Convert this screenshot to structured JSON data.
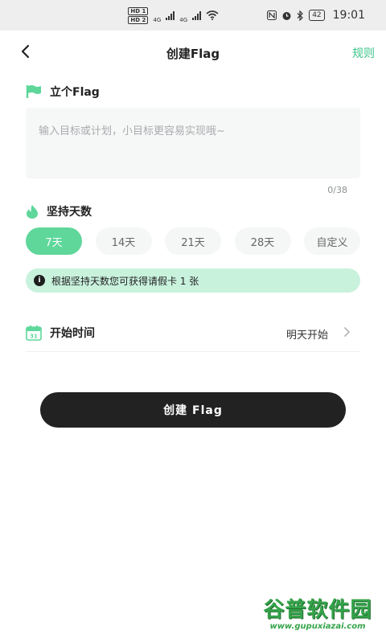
{
  "status_bar": {
    "hd1": "HD 1",
    "hd2": "HD 2",
    "net1": "4G",
    "net2": "4G",
    "battery": "42",
    "time": "19:01"
  },
  "nav": {
    "back_icon": "chevron-left-icon",
    "title": "创建Flag",
    "rules_label": "规则"
  },
  "flag_section": {
    "icon": "flag-icon",
    "title": "立个Flag",
    "placeholder": "输入目标或计划，小目标更容易实现哦~",
    "char_count": "0/38"
  },
  "days_section": {
    "icon": "flame-icon",
    "title": "坚持天数",
    "options": [
      "7天",
      "14天",
      "21天",
      "28天",
      "自定义"
    ],
    "selected": "7天"
  },
  "tip": {
    "icon": "info-icon",
    "text": "根据坚持天数您可获得请假卡 1 张"
  },
  "start_time": {
    "icon": "calendar-icon",
    "calendar_day": "31",
    "label": "开始时间",
    "value": "明天开始",
    "arrow_icon": "chevron-right-icon"
  },
  "submit": {
    "label": "创建 Flag"
  },
  "watermark": {
    "title": "谷普软件园",
    "url": "www.gupuxiazai.com"
  },
  "colors": {
    "accent": "#5fd79b",
    "accent_light": "#c9f2dd",
    "link": "#3cc48a",
    "button": "#222222"
  }
}
